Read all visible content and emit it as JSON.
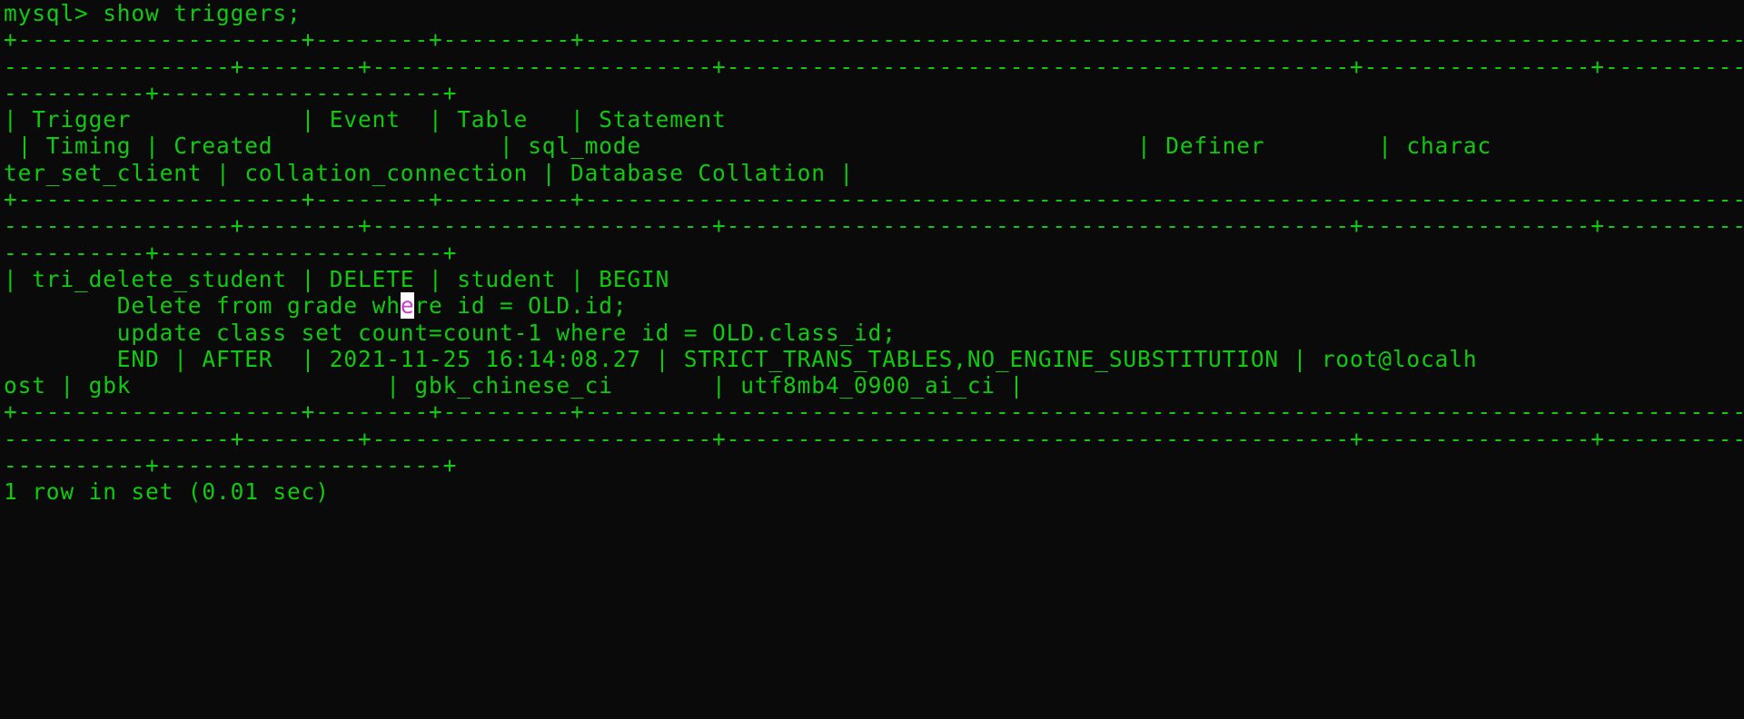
{
  "terminal": {
    "prompt_line": "mysql> show triggers;",
    "border_top1": "+--------------------+--------+---------+------------------------------------------------------------------------------------------------------",
    "border_top2": "----------------+--------+------------------------+--------------------------------------------+----------------+----------------------+------------",
    "border_top3": "----------+--------------------+",
    "header_line1": "| Trigger            | Event  | Table   | Statement",
    "header_line2": " | Timing | Created                | sql_mode                                   | Definer        | charac",
    "header_line3": "ter_set_client | collation_connection | Database Collation |",
    "border_mid1": "+--------------------+--------+---------+------------------------------------------------------------------------------------------------------",
    "border_mid2": "----------------+--------+------------------------+--------------------------------------------+----------------+----------------------+------------",
    "border_mid3": "----------+--------------------+",
    "row_line1a": "| tri_delete_student | DELETE | student | BEGIN",
    "row_line2a": "        Delete from grade wh",
    "row_line2_cursor": "e",
    "row_line2b": "re id = OLD.id;",
    "row_line3": "        update class set count=count-1 where id = OLD.class_id;",
    "row_line4": "        END | AFTER  | 2021-11-25 16:14:08.27 | STRICT_TRANS_TABLES,NO_ENGINE_SUBSTITUTION | root@localh",
    "row_line5": "ost | gbk                  | gbk_chinese_ci       | utf8mb4_0900_ai_ci |",
    "border_bot1": "+--------------------+--------+---------+------------------------------------------------------------------------------------------------------",
    "border_bot2": "----------------+--------+------------------------+--------------------------------------------+----------------+----------------------+------------",
    "border_bot3": "----------+--------------------+",
    "result": "1 row in set (0.01 sec)"
  },
  "chart_data": {
    "type": "table",
    "title": "show triggers",
    "columns": [
      "Trigger",
      "Event",
      "Table",
      "Statement",
      "Timing",
      "Created",
      "sql_mode",
      "Definer",
      "character_set_client",
      "collation_connection",
      "Database Collation"
    ],
    "rows": [
      {
        "Trigger": "tri_delete_student",
        "Event": "DELETE",
        "Table": "student",
        "Statement": "BEGIN\n        Delete from grade where id = OLD.id;\n        update class set count=count-1 where id = OLD.class_id;\n        END",
        "Timing": "AFTER",
        "Created": "2021-11-25 16:14:08.27",
        "sql_mode": "STRICT_TRANS_TABLES,NO_ENGINE_SUBSTITUTION",
        "Definer": "root@localhost",
        "character_set_client": "gbk",
        "collation_connection": "gbk_chinese_ci",
        "Database Collation": "utf8mb4_0900_ai_ci"
      }
    ],
    "footer": "1 row in set (0.01 sec)"
  }
}
